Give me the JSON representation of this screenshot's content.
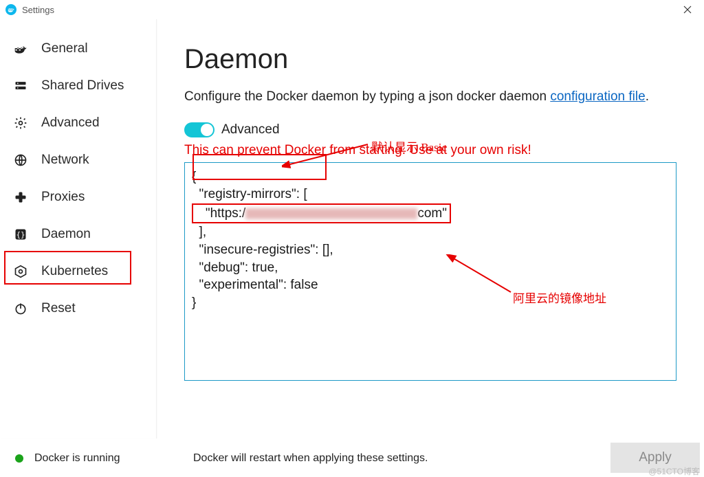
{
  "window": {
    "title": "Settings"
  },
  "sidebar": {
    "items": [
      {
        "label": "General"
      },
      {
        "label": "Shared Drives"
      },
      {
        "label": "Advanced"
      },
      {
        "label": "Network"
      },
      {
        "label": "Proxies"
      },
      {
        "label": "Daemon"
      },
      {
        "label": "Kubernetes"
      },
      {
        "label": "Reset"
      }
    ]
  },
  "main": {
    "heading": "Daemon",
    "desc_prefix": "Configure the Docker daemon by typing a json docker daemon ",
    "desc_link": "configuration file",
    "desc_suffix": ".",
    "toggle_label": "Advanced",
    "toggle_on": true,
    "warning": "This can prevent Docker from starting. Use at your own risk!",
    "editor_value_line1": "{",
    "editor_value_line2": "  \"registry-mirrors\": [",
    "editor_url_prefix": "   \"https:/",
    "editor_url_suffix": "com\"",
    "editor_value_line4": "  ],",
    "editor_value_line5": "  \"insecure-registries\": [],",
    "editor_value_line6": "  \"debug\": true,",
    "editor_value_line7": "  \"experimental\": false",
    "editor_value_line8": "}",
    "daemon_config": {
      "registry-mirrors": [
        "https://[REDACTED].com"
      ],
      "insecure-registries": [],
      "debug": true,
      "experimental": false
    }
  },
  "annotations": {
    "toggle_note": "默认显示 Basic",
    "mirror_note": "阿里云的镜像地址"
  },
  "footer": {
    "status_text": "Docker is running",
    "restart_note": "Docker will restart when applying these settings.",
    "apply_label": "Apply"
  },
  "watermark": "@51CTO博客"
}
